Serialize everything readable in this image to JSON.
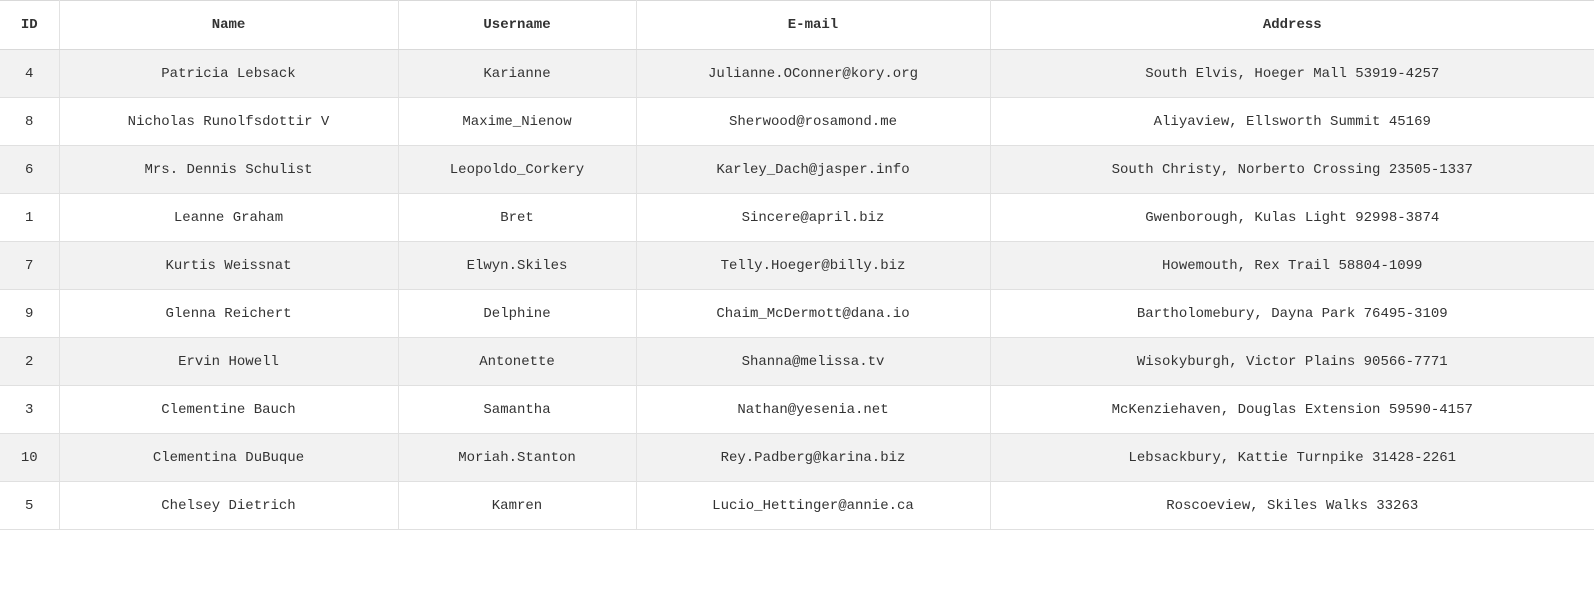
{
  "table": {
    "headers": {
      "id": "ID",
      "name": "Name",
      "username": "Username",
      "email": "E-mail",
      "address": "Address"
    },
    "rows": [
      {
        "id": "4",
        "name": "Patricia Lebsack",
        "username": "Karianne",
        "email": "Julianne.OConner@kory.org",
        "address": "South Elvis, Hoeger Mall 53919-4257"
      },
      {
        "id": "8",
        "name": "Nicholas Runolfsdottir V",
        "username": "Maxime_Nienow",
        "email": "Sherwood@rosamond.me",
        "address": "Aliyaview, Ellsworth Summit 45169"
      },
      {
        "id": "6",
        "name": "Mrs. Dennis Schulist",
        "username": "Leopoldo_Corkery",
        "email": "Karley_Dach@jasper.info",
        "address": "South Christy, Norberto Crossing 23505-1337"
      },
      {
        "id": "1",
        "name": "Leanne Graham",
        "username": "Bret",
        "email": "Sincere@april.biz",
        "address": "Gwenborough, Kulas Light 92998-3874"
      },
      {
        "id": "7",
        "name": "Kurtis Weissnat",
        "username": "Elwyn.Skiles",
        "email": "Telly.Hoeger@billy.biz",
        "address": "Howemouth, Rex Trail 58804-1099"
      },
      {
        "id": "9",
        "name": "Glenna Reichert",
        "username": "Delphine",
        "email": "Chaim_McDermott@dana.io",
        "address": "Bartholomebury, Dayna Park 76495-3109"
      },
      {
        "id": "2",
        "name": "Ervin Howell",
        "username": "Antonette",
        "email": "Shanna@melissa.tv",
        "address": "Wisokyburgh, Victor Plains 90566-7771"
      },
      {
        "id": "3",
        "name": "Clementine Bauch",
        "username": "Samantha",
        "email": "Nathan@yesenia.net",
        "address": "McKenziehaven, Douglas Extension 59590-4157"
      },
      {
        "id": "10",
        "name": "Clementina DuBuque",
        "username": "Moriah.Stanton",
        "email": "Rey.Padberg@karina.biz",
        "address": "Lebsackbury, Kattie Turnpike 31428-2261"
      },
      {
        "id": "5",
        "name": "Chelsey Dietrich",
        "username": "Kamren",
        "email": "Lucio_Hettinger@annie.ca",
        "address": "Roscoeview, Skiles Walks 33263"
      }
    ]
  }
}
